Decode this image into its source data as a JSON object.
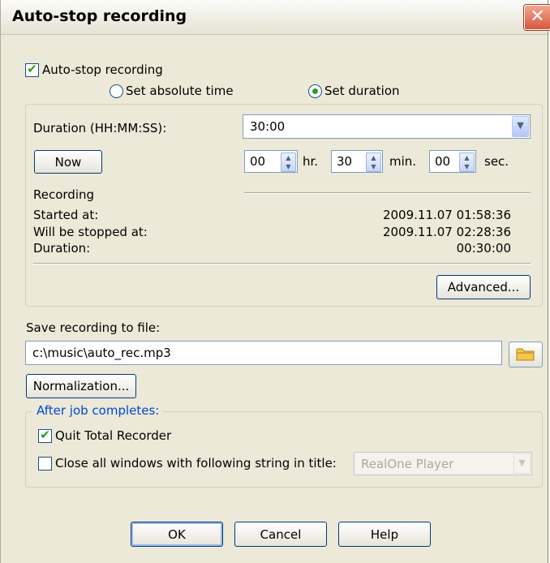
{
  "window": {
    "title": "Auto-stop recording",
    "close_glyph": "✕"
  },
  "autostop": {
    "label": "Auto-stop recording",
    "checked": true
  },
  "mode": {
    "absolute_label": "Set absolute time",
    "duration_label": "Set duration",
    "selected": "duration"
  },
  "duration": {
    "label": "Duration (HH:MM:SS):",
    "value": "30:00",
    "now_button": "Now",
    "hours": "00",
    "hours_unit": "hr.",
    "minutes": "30",
    "minutes_unit": "min.",
    "seconds": "00",
    "seconds_unit": "sec."
  },
  "recording": {
    "heading": "Recording",
    "started_label": "Started at:",
    "started_value": "2009.11.07 01:58:36",
    "stopped_label": "Will be stopped at:",
    "stopped_value": "2009.11.07 02:28:36",
    "duration_label": "Duration:",
    "duration_value": "00:30:00"
  },
  "advanced_button": "Advanced...",
  "save": {
    "label": "Save recording to file:",
    "path": "c:\\music\\auto_rec.mp3"
  },
  "normalization_button": "Normalization...",
  "after_job": {
    "legend": "After job completes:",
    "quit_label": "Quit Total Recorder",
    "quit_checked": true,
    "close_windows_label": "Close all windows with following string in title:",
    "close_windows_checked": false,
    "window_title_value": "RealOne Player"
  },
  "footer": {
    "ok": "OK",
    "cancel": "Cancel",
    "help": "Help"
  },
  "colors": {
    "accent": "#21a121",
    "group_legend": "#0046d5",
    "close_button": "#d8553c"
  },
  "icons": {
    "folder": "folder-icon",
    "dropdown": "chevron-down-icon",
    "spin": "spin-updown-icon"
  }
}
